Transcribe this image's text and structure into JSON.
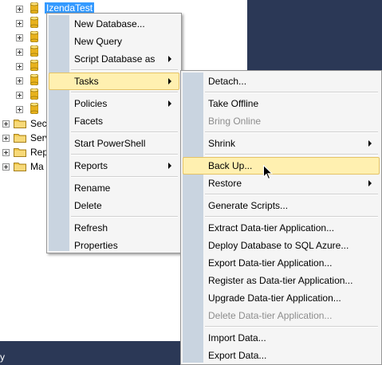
{
  "tree": {
    "databases": [
      {
        "label": "IzendaTest",
        "selected": true
      },
      {
        "label": ""
      },
      {
        "label": ""
      },
      {
        "label": ""
      },
      {
        "label": ""
      },
      {
        "label": ""
      },
      {
        "label": ""
      },
      {
        "label": ""
      }
    ],
    "folders": [
      {
        "label": "Sec"
      },
      {
        "label": "Serv"
      },
      {
        "label": "Rep"
      },
      {
        "label": "Ma"
      }
    ]
  },
  "status_text": "y",
  "context_menu": {
    "items": [
      {
        "label": "New Database..."
      },
      {
        "label": "New Query"
      },
      {
        "label": "Script Database as"
      },
      {
        "label": "Tasks"
      },
      {
        "label": "Policies"
      },
      {
        "label": "Facets"
      },
      {
        "label": "Start PowerShell"
      },
      {
        "label": "Reports"
      },
      {
        "label": "Rename"
      },
      {
        "label": "Delete"
      },
      {
        "label": "Refresh"
      },
      {
        "label": "Properties"
      }
    ]
  },
  "tasks_menu": {
    "items": [
      {
        "label": "Detach..."
      },
      {
        "label": "Take Offline"
      },
      {
        "label": "Bring Online",
        "disabled": true
      },
      {
        "label": "Shrink"
      },
      {
        "label": "Back Up..."
      },
      {
        "label": "Restore"
      },
      {
        "label": "Generate Scripts..."
      },
      {
        "label": "Extract Data-tier Application..."
      },
      {
        "label": "Deploy Database to SQL Azure..."
      },
      {
        "label": "Export Data-tier Application..."
      },
      {
        "label": "Register as Data-tier Application..."
      },
      {
        "label": "Upgrade Data-tier Application..."
      },
      {
        "label": "Delete Data-tier Application...",
        "disabled": true
      },
      {
        "label": "Import Data..."
      },
      {
        "label": "Export Data..."
      }
    ]
  },
  "icons": {
    "database": "database-icon",
    "folder": "folder-icon",
    "expand": "expand-plus-icon",
    "submenu": "submenu-arrow-icon",
    "cursor": "mouse-pointer-icon"
  },
  "colors": {
    "selection": "#3399ff",
    "menu_highlight": "#fff0b0",
    "menu_highlight_border": "#e5c365",
    "gutter": "#c9d4e0",
    "background_navy": "#2b3856"
  }
}
